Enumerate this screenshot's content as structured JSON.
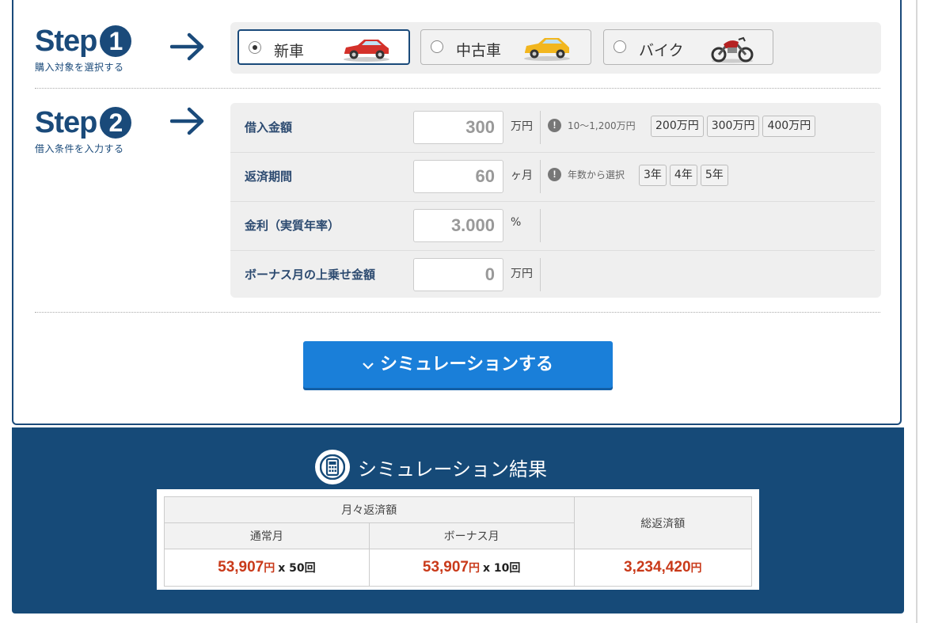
{
  "step1": {
    "word": "Step",
    "num": "1",
    "sub": "購入対象を選択する"
  },
  "step2": {
    "word": "Step",
    "num": "2",
    "sub": "借入条件を入力する"
  },
  "vehicles": [
    {
      "label": "新車",
      "selected": true,
      "icon": "red-car-icon",
      "color": "#d4312a"
    },
    {
      "label": "中古車",
      "selected": false,
      "icon": "yellow-car-icon",
      "color": "#f2b61e"
    },
    {
      "label": "バイク",
      "selected": false,
      "icon": "motorcycle-icon",
      "color": "#b52222"
    }
  ],
  "form": {
    "amount": {
      "label": "借入金額",
      "value": "300",
      "unit": "万円",
      "note": "10〜1,200万円",
      "chips": [
        "200万円",
        "300万円",
        "400万円"
      ]
    },
    "period": {
      "label": "返済期間",
      "value": "60",
      "unit": "ヶ月",
      "note": "年数から選択",
      "chips": [
        "3年",
        "4年",
        "5年"
      ]
    },
    "rate": {
      "label": "金利（実質年率）",
      "value": "3.000",
      "unit": "%"
    },
    "bonus": {
      "label": "ボーナス月の上乗せ金額",
      "value": "0",
      "unit": "万円"
    }
  },
  "simulate_button": "シミュレーションする",
  "results": {
    "title": "シミュレーション結果",
    "monthly_header": "月々返済額",
    "total_header": "総返済額",
    "normal_header": "通常月",
    "bonus_header": "ボーナス月",
    "normal_amount": "53,907",
    "normal_times": "x 50回",
    "bonus_amount": "53,907",
    "bonus_times": "x 10回",
    "total_amount": "3,234,420",
    "yen": "円"
  },
  "colors": {
    "navy": "#1a4a7a",
    "result_bg": "#164a78",
    "button": "#1a7fd9",
    "amount_red": "#c93a1a"
  }
}
